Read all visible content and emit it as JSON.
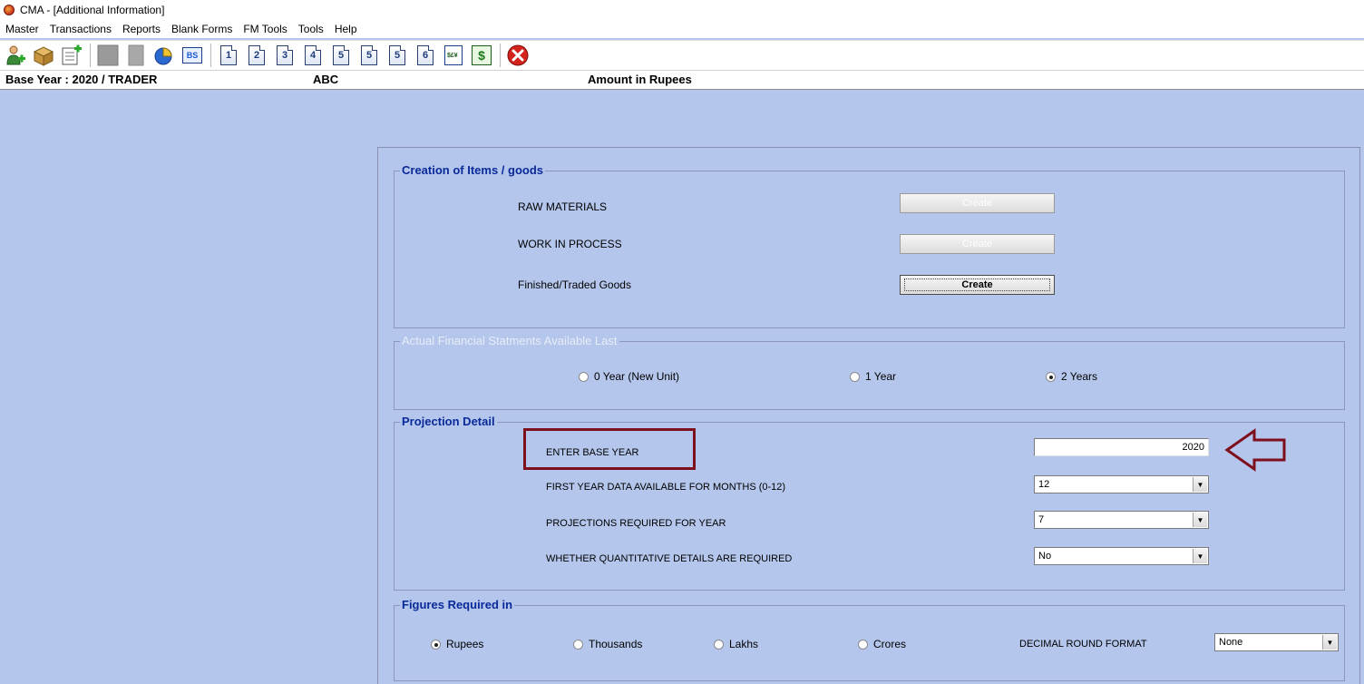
{
  "window": {
    "title": "CMA - [Additional Information]"
  },
  "menu": [
    "Master",
    "Transactions",
    "Reports",
    "Blank Forms",
    "FM Tools",
    "Tools",
    "Help"
  ],
  "toolbar": {
    "numbers": [
      "1",
      "2",
      "3",
      "4",
      "5",
      "5",
      "5",
      "6"
    ],
    "currency_glyph": "$£¥",
    "dollar_glyph": "$",
    "bs_glyph": "BS"
  },
  "infobar": {
    "base_year": "Base Year : 2020 / TRADER",
    "company": "ABC",
    "amount_unit": "Amount in Rupees"
  },
  "items_group": {
    "title": "Creation of Items / goods",
    "rows": [
      {
        "label": "RAW MATERIALS",
        "button": "Create",
        "enabled": false
      },
      {
        "label": "WORK IN PROCESS",
        "button": "Create",
        "enabled": false
      },
      {
        "label": "Finished/Traded Goods",
        "button": "Create",
        "enabled": true
      }
    ]
  },
  "financial_group": {
    "title": "Actual Financial Statments Available Last",
    "options": [
      "0 Year (New Unit)",
      "1 Year",
      "2 Years"
    ],
    "selected": "2 Years"
  },
  "projection_group": {
    "title": "Projection Detail",
    "base_year_label": "ENTER BASE YEAR",
    "base_year_value": "2020",
    "months_label": "FIRST YEAR DATA AVAILABLE FOR MONTHS (0-12)",
    "months_value": "12",
    "projection_label": "PROJECTIONS REQUIRED FOR  YEAR",
    "projection_value": "7",
    "quantitative_label": "WHETHER QUANTITATIVE DETAILS ARE REQUIRED",
    "quantitative_value": "No"
  },
  "figures_group": {
    "title": "Figures Required in",
    "options": [
      "Rupees",
      "Thousands",
      "Lakhs",
      "Crores"
    ],
    "selected": "Rupees",
    "decimal_label": "DECIMAL ROUND FORMAT",
    "decimal_value": "None"
  },
  "colors": {
    "background": "#b4c6ec",
    "group_title": "#0a2a9a",
    "annotation": "#7e0f1c"
  }
}
